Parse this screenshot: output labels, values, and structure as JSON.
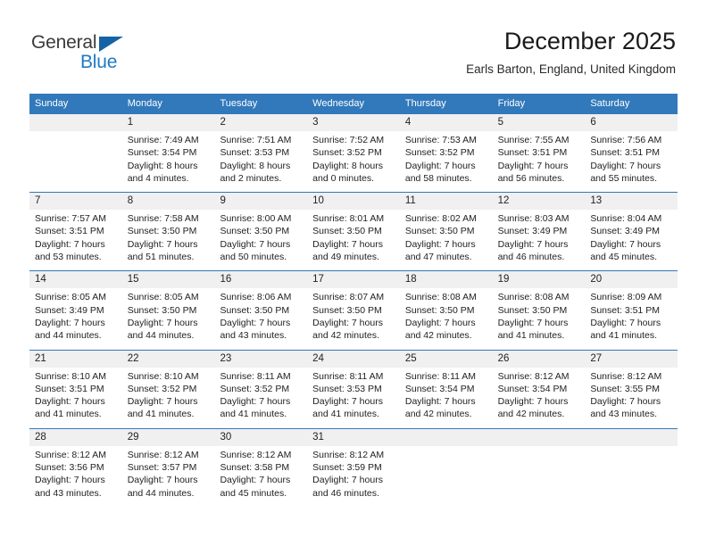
{
  "logo": {
    "word_one": "General",
    "word_two": "Blue",
    "triangle_color": "#1464a5",
    "blue_color": "#1f7ac4"
  },
  "header": {
    "title": "December 2025",
    "subtitle": "Earls Barton, England, United Kingdom"
  },
  "theme": {
    "header_blue": "#3279bb",
    "daynum_band": "#f0f0f0",
    "text": "#222222"
  },
  "calendar": {
    "weekday_headers": [
      "Sunday",
      "Monday",
      "Tuesday",
      "Wednesday",
      "Thursday",
      "Friday",
      "Saturday"
    ],
    "weeks": [
      [
        {
          "day": "",
          "sunrise": "",
          "sunset": "",
          "daylight_line1": "",
          "daylight_line2": ""
        },
        {
          "day": "1",
          "sunrise": "Sunrise: 7:49 AM",
          "sunset": "Sunset: 3:54 PM",
          "daylight_line1": "Daylight: 8 hours",
          "daylight_line2": "and 4 minutes."
        },
        {
          "day": "2",
          "sunrise": "Sunrise: 7:51 AM",
          "sunset": "Sunset: 3:53 PM",
          "daylight_line1": "Daylight: 8 hours",
          "daylight_line2": "and 2 minutes."
        },
        {
          "day": "3",
          "sunrise": "Sunrise: 7:52 AM",
          "sunset": "Sunset: 3:52 PM",
          "daylight_line1": "Daylight: 8 hours",
          "daylight_line2": "and 0 minutes."
        },
        {
          "day": "4",
          "sunrise": "Sunrise: 7:53 AM",
          "sunset": "Sunset: 3:52 PM",
          "daylight_line1": "Daylight: 7 hours",
          "daylight_line2": "and 58 minutes."
        },
        {
          "day": "5",
          "sunrise": "Sunrise: 7:55 AM",
          "sunset": "Sunset: 3:51 PM",
          "daylight_line1": "Daylight: 7 hours",
          "daylight_line2": "and 56 minutes."
        },
        {
          "day": "6",
          "sunrise": "Sunrise: 7:56 AM",
          "sunset": "Sunset: 3:51 PM",
          "daylight_line1": "Daylight: 7 hours",
          "daylight_line2": "and 55 minutes."
        }
      ],
      [
        {
          "day": "7",
          "sunrise": "Sunrise: 7:57 AM",
          "sunset": "Sunset: 3:51 PM",
          "daylight_line1": "Daylight: 7 hours",
          "daylight_line2": "and 53 minutes."
        },
        {
          "day": "8",
          "sunrise": "Sunrise: 7:58 AM",
          "sunset": "Sunset: 3:50 PM",
          "daylight_line1": "Daylight: 7 hours",
          "daylight_line2": "and 51 minutes."
        },
        {
          "day": "9",
          "sunrise": "Sunrise: 8:00 AM",
          "sunset": "Sunset: 3:50 PM",
          "daylight_line1": "Daylight: 7 hours",
          "daylight_line2": "and 50 minutes."
        },
        {
          "day": "10",
          "sunrise": "Sunrise: 8:01 AM",
          "sunset": "Sunset: 3:50 PM",
          "daylight_line1": "Daylight: 7 hours",
          "daylight_line2": "and 49 minutes."
        },
        {
          "day": "11",
          "sunrise": "Sunrise: 8:02 AM",
          "sunset": "Sunset: 3:50 PM",
          "daylight_line1": "Daylight: 7 hours",
          "daylight_line2": "and 47 minutes."
        },
        {
          "day": "12",
          "sunrise": "Sunrise: 8:03 AM",
          "sunset": "Sunset: 3:49 PM",
          "daylight_line1": "Daylight: 7 hours",
          "daylight_line2": "and 46 minutes."
        },
        {
          "day": "13",
          "sunrise": "Sunrise: 8:04 AM",
          "sunset": "Sunset: 3:49 PM",
          "daylight_line1": "Daylight: 7 hours",
          "daylight_line2": "and 45 minutes."
        }
      ],
      [
        {
          "day": "14",
          "sunrise": "Sunrise: 8:05 AM",
          "sunset": "Sunset: 3:49 PM",
          "daylight_line1": "Daylight: 7 hours",
          "daylight_line2": "and 44 minutes."
        },
        {
          "day": "15",
          "sunrise": "Sunrise: 8:05 AM",
          "sunset": "Sunset: 3:50 PM",
          "daylight_line1": "Daylight: 7 hours",
          "daylight_line2": "and 44 minutes."
        },
        {
          "day": "16",
          "sunrise": "Sunrise: 8:06 AM",
          "sunset": "Sunset: 3:50 PM",
          "daylight_line1": "Daylight: 7 hours",
          "daylight_line2": "and 43 minutes."
        },
        {
          "day": "17",
          "sunrise": "Sunrise: 8:07 AM",
          "sunset": "Sunset: 3:50 PM",
          "daylight_line1": "Daylight: 7 hours",
          "daylight_line2": "and 42 minutes."
        },
        {
          "day": "18",
          "sunrise": "Sunrise: 8:08 AM",
          "sunset": "Sunset: 3:50 PM",
          "daylight_line1": "Daylight: 7 hours",
          "daylight_line2": "and 42 minutes."
        },
        {
          "day": "19",
          "sunrise": "Sunrise: 8:08 AM",
          "sunset": "Sunset: 3:50 PM",
          "daylight_line1": "Daylight: 7 hours",
          "daylight_line2": "and 41 minutes."
        },
        {
          "day": "20",
          "sunrise": "Sunrise: 8:09 AM",
          "sunset": "Sunset: 3:51 PM",
          "daylight_line1": "Daylight: 7 hours",
          "daylight_line2": "and 41 minutes."
        }
      ],
      [
        {
          "day": "21",
          "sunrise": "Sunrise: 8:10 AM",
          "sunset": "Sunset: 3:51 PM",
          "daylight_line1": "Daylight: 7 hours",
          "daylight_line2": "and 41 minutes."
        },
        {
          "day": "22",
          "sunrise": "Sunrise: 8:10 AM",
          "sunset": "Sunset: 3:52 PM",
          "daylight_line1": "Daylight: 7 hours",
          "daylight_line2": "and 41 minutes."
        },
        {
          "day": "23",
          "sunrise": "Sunrise: 8:11 AM",
          "sunset": "Sunset: 3:52 PM",
          "daylight_line1": "Daylight: 7 hours",
          "daylight_line2": "and 41 minutes."
        },
        {
          "day": "24",
          "sunrise": "Sunrise: 8:11 AM",
          "sunset": "Sunset: 3:53 PM",
          "daylight_line1": "Daylight: 7 hours",
          "daylight_line2": "and 41 minutes."
        },
        {
          "day": "25",
          "sunrise": "Sunrise: 8:11 AM",
          "sunset": "Sunset: 3:54 PM",
          "daylight_line1": "Daylight: 7 hours",
          "daylight_line2": "and 42 minutes."
        },
        {
          "day": "26",
          "sunrise": "Sunrise: 8:12 AM",
          "sunset": "Sunset: 3:54 PM",
          "daylight_line1": "Daylight: 7 hours",
          "daylight_line2": "and 42 minutes."
        },
        {
          "day": "27",
          "sunrise": "Sunrise: 8:12 AM",
          "sunset": "Sunset: 3:55 PM",
          "daylight_line1": "Daylight: 7 hours",
          "daylight_line2": "and 43 minutes."
        }
      ],
      [
        {
          "day": "28",
          "sunrise": "Sunrise: 8:12 AM",
          "sunset": "Sunset: 3:56 PM",
          "daylight_line1": "Daylight: 7 hours",
          "daylight_line2": "and 43 minutes."
        },
        {
          "day": "29",
          "sunrise": "Sunrise: 8:12 AM",
          "sunset": "Sunset: 3:57 PM",
          "daylight_line1": "Daylight: 7 hours",
          "daylight_line2": "and 44 minutes."
        },
        {
          "day": "30",
          "sunrise": "Sunrise: 8:12 AM",
          "sunset": "Sunset: 3:58 PM",
          "daylight_line1": "Daylight: 7 hours",
          "daylight_line2": "and 45 minutes."
        },
        {
          "day": "31",
          "sunrise": "Sunrise: 8:12 AM",
          "sunset": "Sunset: 3:59 PM",
          "daylight_line1": "Daylight: 7 hours",
          "daylight_line2": "and 46 minutes."
        },
        {
          "day": "",
          "sunrise": "",
          "sunset": "",
          "daylight_line1": "",
          "daylight_line2": ""
        },
        {
          "day": "",
          "sunrise": "",
          "sunset": "",
          "daylight_line1": "",
          "daylight_line2": ""
        },
        {
          "day": "",
          "sunrise": "",
          "sunset": "",
          "daylight_line1": "",
          "daylight_line2": ""
        }
      ]
    ]
  }
}
